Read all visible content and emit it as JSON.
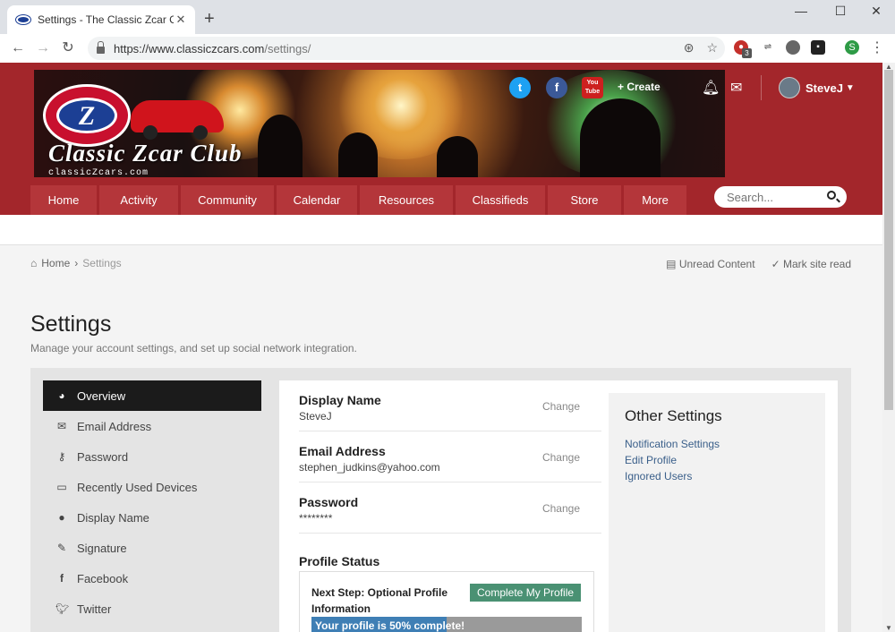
{
  "browser": {
    "tab_title": "Settings - The Classic Zcar Club",
    "url_host": "https://www.classiczcars.com",
    "url_path": "/settings/",
    "profile_initial": "S",
    "ext_badge": "3"
  },
  "header": {
    "logo_text": "Classic Zcar Club",
    "logo_sub": "classicZcars.com",
    "logo_letter": "Z",
    "create_label": "+ Create",
    "username": "SteveJ",
    "social": {
      "twitter": "t",
      "facebook": "f",
      "youtube": "You Tube"
    }
  },
  "nav": {
    "items": [
      "Home",
      "Activity",
      "Community",
      "Calendar",
      "Resources",
      "Classifieds",
      "Store",
      "More"
    ],
    "search_placeholder": "Search..."
  },
  "breadcrumb": {
    "home": "Home",
    "current": "Settings",
    "unread": "Unread Content",
    "mark_read": "Mark site read"
  },
  "page": {
    "title": "Settings",
    "description": "Manage your account settings, and set up social network integration."
  },
  "sidebar": {
    "items": [
      {
        "label": "Overview",
        "icon": "dashboard-icon"
      },
      {
        "label": "Email Address",
        "icon": "envelope-icon"
      },
      {
        "label": "Password",
        "icon": "key-icon"
      },
      {
        "label": "Recently Used Devices",
        "icon": "laptop-icon"
      },
      {
        "label": "Display Name",
        "icon": "user-icon"
      },
      {
        "label": "Signature",
        "icon": "pencil-icon"
      },
      {
        "label": "Facebook",
        "icon": "facebook-icon"
      },
      {
        "label": "Twitter",
        "icon": "twitter-icon"
      }
    ]
  },
  "settings": {
    "display_name": {
      "label": "Display Name",
      "value": "SteveJ",
      "action": "Change"
    },
    "email": {
      "label": "Email Address",
      "value": "stephen_judkins@yahoo.com",
      "action": "Change"
    },
    "password": {
      "label": "Password",
      "value": "********",
      "action": "Change"
    },
    "profile_status": {
      "title": "Profile Status",
      "next_step": "Next Step: Optional Profile Information",
      "button": "Complete My Profile",
      "progress_text": "Your profile is 50% complete!",
      "progress": 0.5
    }
  },
  "other_settings": {
    "title": "Other Settings",
    "links": [
      "Notification Settings",
      "Edit Profile",
      "Ignored Users"
    ]
  },
  "colors": {
    "header_red": "#a3262b",
    "nav_item": "#b4363a",
    "accent_green": "#4a9173",
    "progress_blue": "#3f7fb5"
  }
}
